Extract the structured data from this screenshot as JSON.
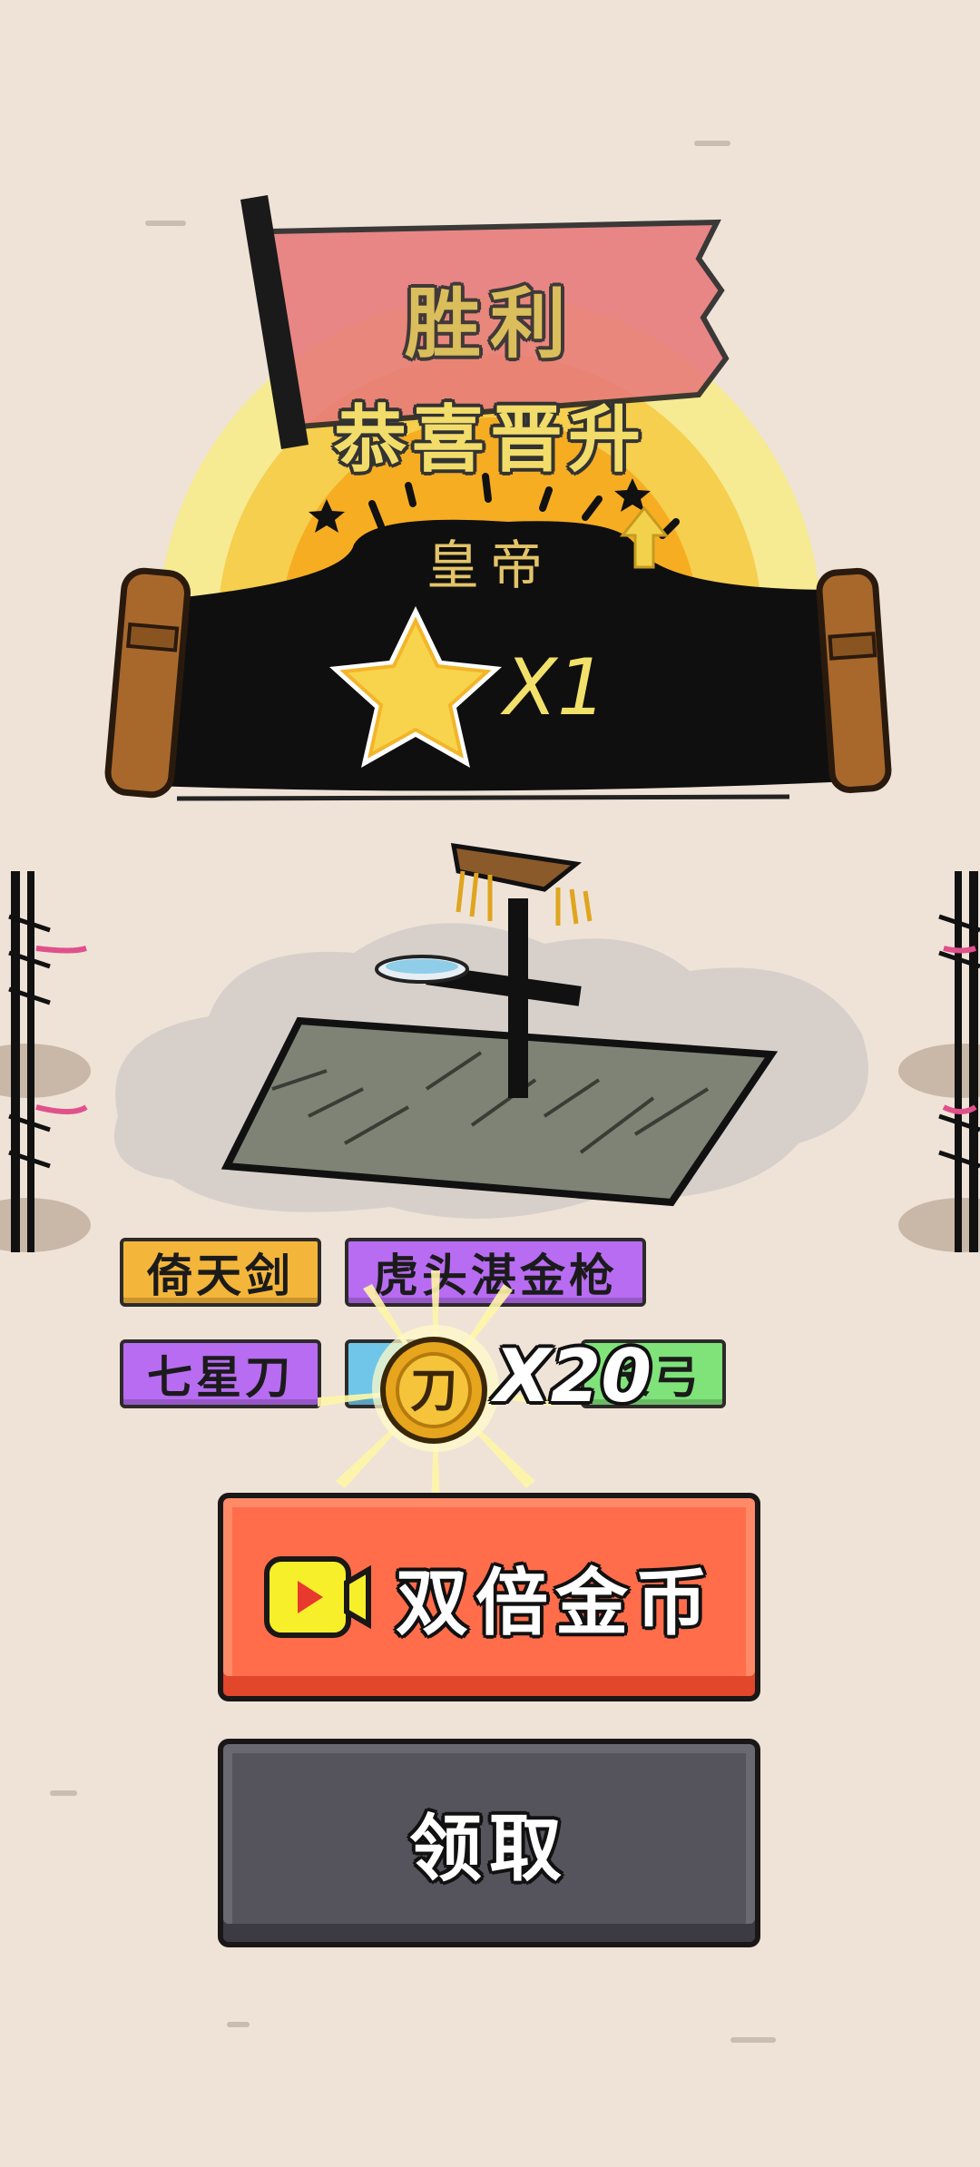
{
  "result": {
    "victory_title": "胜利",
    "promotion_title": "恭喜晋升",
    "rank_name": "皇帝",
    "star_reward": "X1"
  },
  "weapons": {
    "row1": [
      "倚天剑",
      "虎头湛金枪"
    ],
    "row2": [
      "七星刀",
      "",
      "长弓"
    ]
  },
  "coin_reward": {
    "coin_glyph": "刀",
    "amount": "X20"
  },
  "buttons": {
    "double_coins_label": "双倍金币",
    "claim_label": "领取"
  },
  "colors": {
    "background": "#efe3d8",
    "flag": "#e87a7a",
    "double_button": "#ff6d4b",
    "claim_button": "#55545d",
    "tag_gold": "#f4b63a",
    "tag_purple": "#b86cf2",
    "tag_blue": "#6fc6e8",
    "tag_green": "#7fe37a"
  },
  "icons": [
    "star-icon",
    "arrow-up-icon",
    "video-icon",
    "coin-icon",
    "weapon-rack-icon",
    "flag-icon"
  ]
}
